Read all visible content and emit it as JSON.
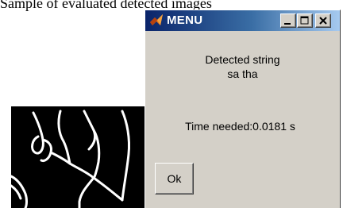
{
  "background": {
    "caption_text": "Sample of evaluated detected images",
    "binary_image": {
      "background_color": "#000000",
      "stroke_color": "#ffffff"
    }
  },
  "window": {
    "title": "MENU",
    "icon": "matlab-icon",
    "titlebar_colors": [
      "#0a246a",
      "#a6caf0"
    ],
    "controls": {
      "minimize": "minimize-icon",
      "maximize": "maximize-icon",
      "close": "close-icon"
    },
    "body_color": "#d4d0c8"
  },
  "dialog": {
    "label": "Detected string",
    "detected_string": "sa tha",
    "time_text": "Time needed:0.0181 s",
    "ok_label": "Ok"
  }
}
